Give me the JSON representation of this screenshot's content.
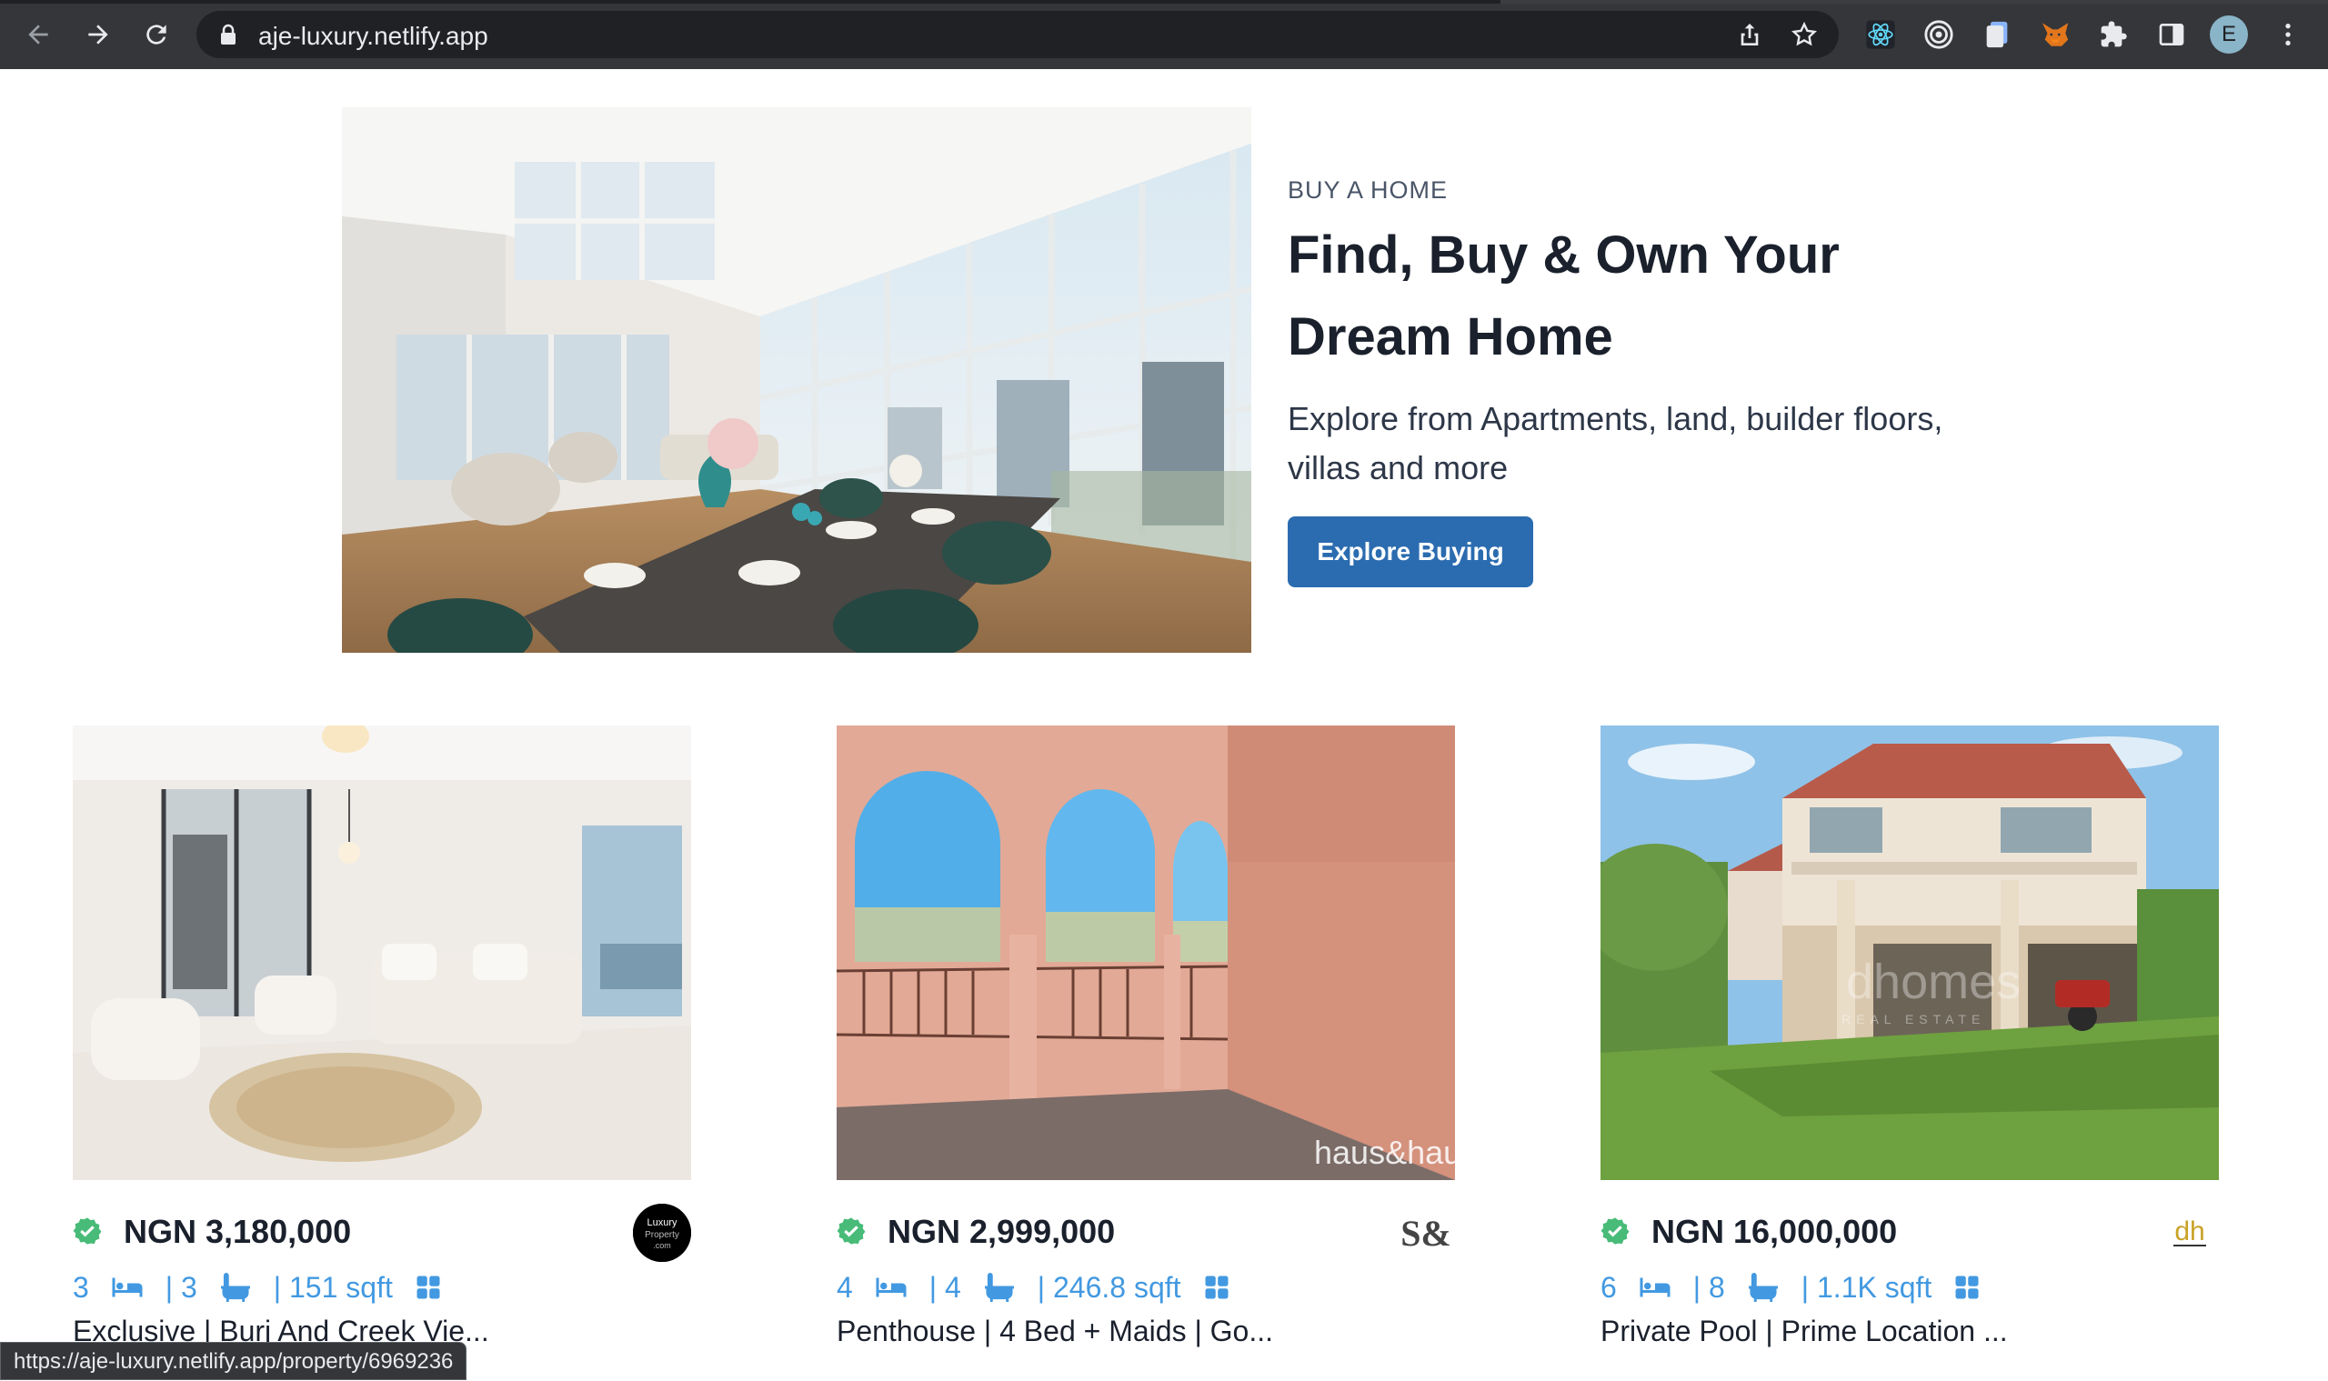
{
  "browser": {
    "url": "aje-luxury.netlify.app",
    "avatar_letter": "E",
    "status_url": "https://aje-luxury.netlify.app/property/6969236"
  },
  "hero": {
    "kicker": "BUY A HOME",
    "title_line1": "Find, Buy & Own Your",
    "title_line2": "Dream Home",
    "description": "Explore from Apartments, land, builder floors, villas and more",
    "cta_label": "Explore Buying"
  },
  "properties": [
    {
      "price": "NGN 3,180,000",
      "rooms": "3",
      "baths": "| 3",
      "area": "| 151 sqft",
      "title": "Exclusive | Burj And Creek Vie...",
      "agency": "Luxury Property .com"
    },
    {
      "price": "NGN 2,999,000",
      "rooms": "4",
      "baths": "| 4",
      "area": "| 246.8 sqft",
      "title": "Penthouse | 4 Bed + Maids | Go...",
      "agency": "S&"
    },
    {
      "price": "NGN 16,000,000",
      "rooms": "6",
      "baths": "| 8",
      "area": "| 1.1K sqft",
      "title": "Private Pool | Prime Location ...",
      "agency": "dh"
    }
  ],
  "watermarks": {
    "haus": "haus&haus",
    "dh": "dhomes",
    "dh_sub": "REAL ESTATE"
  },
  "colors": {
    "accent": "#2b6cb0",
    "facts": "#4299e1",
    "verified": "#48bb78"
  }
}
